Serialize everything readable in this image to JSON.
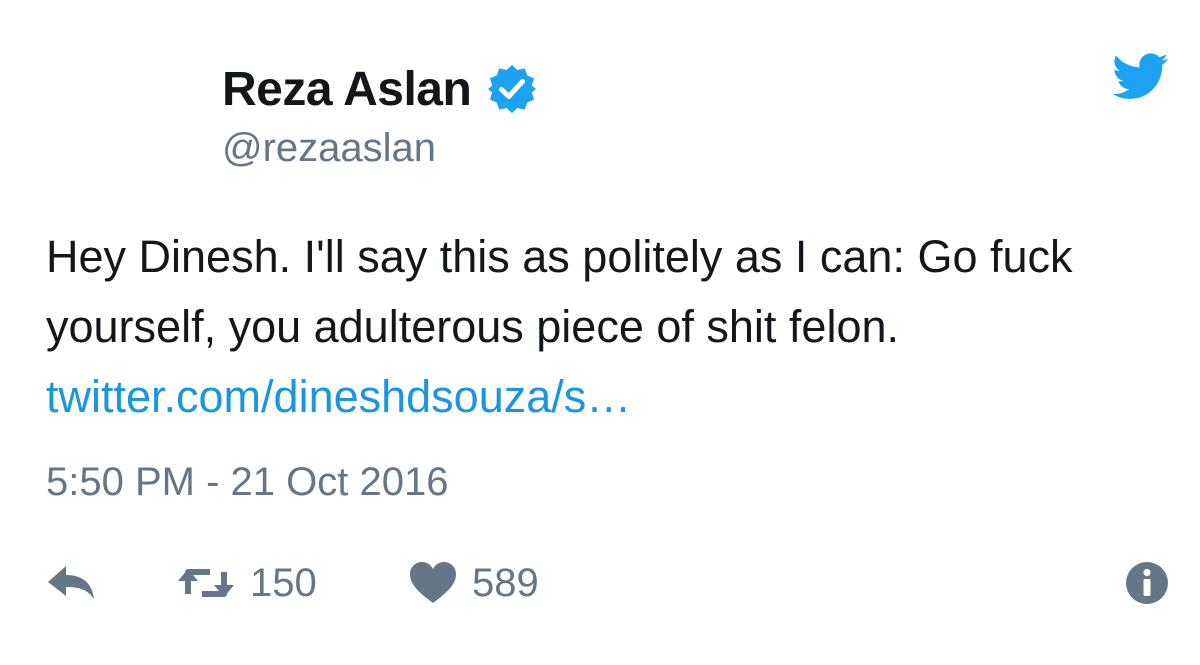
{
  "user": {
    "display_name": "Reza Aslan",
    "handle": "@rezaaslan",
    "verified": true
  },
  "tweet": {
    "text": "Hey Dinesh. I'll say this as politely as I can: Go fuck yourself, you adulterous piece of shit felon.",
    "link_text": "twitter.com/dineshdsouza/s…",
    "timestamp": "5:50 PM - 21 Oct 2016"
  },
  "actions": {
    "retweet_count": "150",
    "like_count": "589"
  },
  "icons": {
    "brand": "twitter-bird-icon",
    "verified": "verified-badge-icon",
    "reply": "reply-icon",
    "retweet": "retweet-icon",
    "like": "heart-icon",
    "info": "info-icon"
  },
  "colors": {
    "twitter_blue": "#1da1f2",
    "link": "#1b95e0",
    "secondary_text": "#657786",
    "primary_text": "#14171a"
  }
}
